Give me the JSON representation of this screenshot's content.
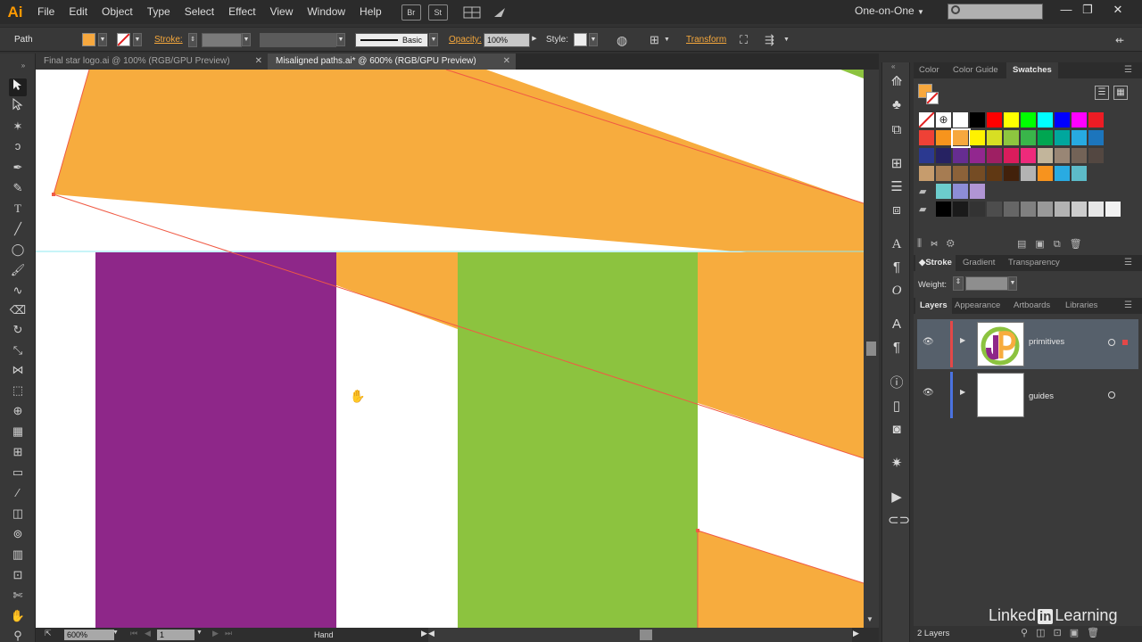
{
  "app": {
    "logo": "Ai",
    "workspace": "One-on-One",
    "win_minimize": "—",
    "win_restore": "❐",
    "win_close": "✕"
  },
  "menus": [
    "File",
    "Edit",
    "Object",
    "Type",
    "Select",
    "Effect",
    "View",
    "Window",
    "Help"
  ],
  "menubar_icons": {
    "bridge": "Br",
    "stock": "St"
  },
  "control_bar": {
    "selection_label": "Path",
    "stroke_label": "Stroke:",
    "stroke_style": "Basic",
    "opacity_label": "Opacity:",
    "opacity_value": "100%",
    "style_label": "Style:",
    "transform_label": "Transform",
    "fill_color": "#f7a83e"
  },
  "doc_tabs": [
    {
      "label": "Final star logo.ai @ 100% (RGB/GPU Preview)",
      "active": false
    },
    {
      "label": "Misaligned paths.ai* @ 600% (RGB/GPU Preview)",
      "active": true
    }
  ],
  "status_bar": {
    "zoom": "600%",
    "artboard": "1",
    "current_tool": "Hand"
  },
  "artwork": {
    "orange": "#f7ac3e",
    "purple": "#8e2789",
    "green": "#8cc33f",
    "path_color": "#f05a44",
    "guide_color": "#8fe8f0"
  },
  "color_panel": {
    "tabs": [
      "Color",
      "Color Guide",
      "Swatches"
    ],
    "active": "Swatches"
  },
  "swatches": {
    "row1": [
      "#ffffff",
      "#000000",
      "#ff0000",
      "#ffff00",
      "#00ff00",
      "#00ffff",
      "#0000ff",
      "#ff00ff",
      "#ed1c24"
    ],
    "row2": [
      "#ef4136",
      "#f7941d",
      "#f7a83e",
      "#fff200",
      "#d7df23",
      "#8dc63f",
      "#39b54a",
      "#00a651",
      "#00a79d",
      "#27aae1",
      "#1c75bc"
    ],
    "row3": [
      "#2b3990",
      "#262262",
      "#662d91",
      "#92278f",
      "#9e1f63",
      "#da1c5c",
      "#ee2a7b",
      "#c2b59b",
      "#998675",
      "#736357",
      "#534741"
    ],
    "row4": [
      "#c69c6d",
      "#a67c52",
      "#8c6239",
      "#754c24",
      "#603813",
      "#42210b",
      "#b3b3b3",
      "#f7931e",
      "#29abe2",
      "#5dbbc8"
    ],
    "row5": [
      "#6ccccc",
      "#8d8dd6",
      "#b095d4"
    ],
    "row6": [
      "#000000",
      "#1a1a1a",
      "#333333",
      "#4d4d4d",
      "#666666",
      "#808080",
      "#999999",
      "#b3b3b3",
      "#cccccc",
      "#e6e6e6",
      "#f2f2f2"
    ]
  },
  "stroke_panel": {
    "tabs": [
      "Stroke",
      "Gradient",
      "Transparency"
    ],
    "active": "Stroke",
    "weight_label": "Weight:"
  },
  "layers_panel": {
    "tabs": [
      "Layers",
      "Appearance",
      "Artboards",
      "Libraries"
    ],
    "active": "Layers",
    "layers": [
      {
        "name": "primitives",
        "color": "#e34848",
        "thumb": "JP"
      },
      {
        "name": "guides",
        "color": "#4a72e0",
        "thumb": ""
      }
    ],
    "count_label": "2 Layers"
  },
  "watermark": {
    "brand_a": "Linked",
    "brand_in": "in",
    "brand_b": "Learning"
  }
}
